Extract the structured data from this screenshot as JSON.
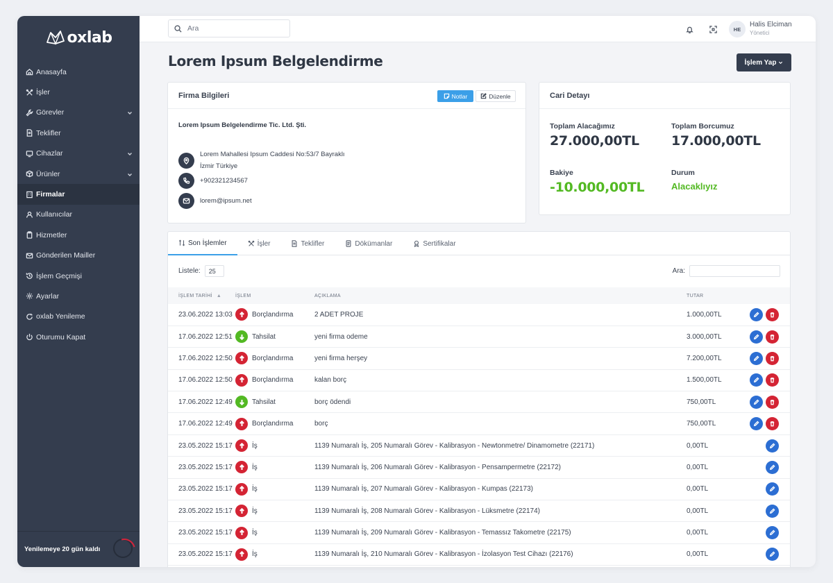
{
  "brand": {
    "logo_text": "oxlab"
  },
  "sidebar": {
    "items": [
      {
        "label": "Anasayfa",
        "icon": "home-icon",
        "chevron": false,
        "active": false
      },
      {
        "label": "İşler",
        "icon": "tools-icon",
        "chevron": false,
        "active": false
      },
      {
        "label": "Görevler",
        "icon": "wrench-icon",
        "chevron": true,
        "active": false
      },
      {
        "label": "Teklifler",
        "icon": "document-icon",
        "chevron": false,
        "active": false
      },
      {
        "label": "Cihazlar",
        "icon": "device-icon",
        "chevron": true,
        "active": false
      },
      {
        "label": "Ürünler",
        "icon": "box-icon",
        "chevron": true,
        "active": false
      },
      {
        "label": "Firmalar",
        "icon": "building-icon",
        "chevron": false,
        "active": true
      },
      {
        "label": "Kullanıcılar",
        "icon": "user-icon",
        "chevron": false,
        "active": false
      },
      {
        "label": "Hizmetler",
        "icon": "clipboard-icon",
        "chevron": false,
        "active": false
      },
      {
        "label": "Gönderilen Mailler",
        "icon": "mail-icon",
        "chevron": false,
        "active": false
      },
      {
        "label": "İşlem Geçmişi",
        "icon": "history-icon",
        "chevron": false,
        "active": false
      },
      {
        "label": "Ayarlar",
        "icon": "gear-icon",
        "chevron": false,
        "active": false
      },
      {
        "label": "oxlab Yenileme",
        "icon": "refresh-icon",
        "chevron": false,
        "active": false
      },
      {
        "label": "Oturumu Kapat",
        "icon": "power-icon",
        "chevron": false,
        "active": false
      }
    ],
    "renewal_text": "Yenilemeye 20 gün kaldı"
  },
  "topbar": {
    "search_placeholder": "Ara",
    "user_initials": "HE",
    "user_name": "Halis Elciman",
    "user_role": "Yönetici"
  },
  "page": {
    "title": "Lorem Ipsum Belgelendirme",
    "action_button": "İşlem Yap"
  },
  "firm": {
    "header": "Firma Bilgileri",
    "notes_button": "Notlar",
    "edit_button": "Düzenle",
    "name": "Lorem Ipsum Belgelendirme Tic. Ltd. Şti.",
    "address_line1": "Lorem Mahallesi Ipsum Caddesi No:53/7 Bayraklı",
    "address_line2": "İzmir Türkiye",
    "phone": "+902321234567",
    "email": "lorem@ipsum.net"
  },
  "cari": {
    "header": "Cari Detayı",
    "receivable_label": "Toplam Alacağımız",
    "receivable_value": "27.000,00TL",
    "debt_label": "Toplam Borcumuz",
    "debt_value": "17.000,00TL",
    "balance_label": "Bakiye",
    "balance_value": "-10.000,00TL",
    "status_label": "Durum",
    "status_value": "Alacaklıyız"
  },
  "tabs": [
    {
      "label": "Son İşlemler",
      "icon": "swap-icon"
    },
    {
      "label": "İşler",
      "icon": "tools-icon"
    },
    {
      "label": "Teklifler",
      "icon": "document-icon"
    },
    {
      "label": "Dökümanlar",
      "icon": "file-icon"
    },
    {
      "label": "Sertifikalar",
      "icon": "award-icon"
    }
  ],
  "table": {
    "list_label": "Listele:",
    "list_size": "25",
    "search_label": "Ara:",
    "columns": [
      "İŞLEM TARİHİ",
      "İŞLEM",
      "AÇIKLAMA",
      "TUTAR"
    ],
    "rows": [
      {
        "date": "23.06.2022 13:03",
        "type": "Borçlandırma",
        "dir": "up",
        "desc": "2 ADET PROJE",
        "amount": "1.000,00TL",
        "deletable": true
      },
      {
        "date": "17.06.2022 12:51",
        "type": "Tahsilat",
        "dir": "down",
        "desc": "yeni firma odeme",
        "amount": "3.000,00TL",
        "deletable": true
      },
      {
        "date": "17.06.2022 12:50",
        "type": "Borçlandırma",
        "dir": "up",
        "desc": "yeni firma herşey",
        "amount": "7.200,00TL",
        "deletable": true
      },
      {
        "date": "17.06.2022 12:50",
        "type": "Borçlandırma",
        "dir": "up",
        "desc": "kalan borç",
        "amount": "1.500,00TL",
        "deletable": true
      },
      {
        "date": "17.06.2022 12:49",
        "type": "Tahsilat",
        "dir": "down",
        "desc": "borç ödendi",
        "amount": "750,00TL",
        "deletable": true
      },
      {
        "date": "17.06.2022 12:49",
        "type": "Borçlandırma",
        "dir": "up",
        "desc": "borç",
        "amount": "750,00TL",
        "deletable": true
      },
      {
        "date": "23.05.2022 15:17",
        "type": "İş",
        "dir": "up",
        "desc": "1139 Numaralı İş, 205 Numaralı Görev - Kalibrasyon - Newtonmetre/ Dinamometre (22171)",
        "amount": "0,00TL",
        "deletable": false
      },
      {
        "date": "23.05.2022 15:17",
        "type": "İş",
        "dir": "up",
        "desc": "1139 Numaralı İş, 206 Numaralı Görev - Kalibrasyon - Pensampermetre (22172)",
        "amount": "0,00TL",
        "deletable": false
      },
      {
        "date": "23.05.2022 15:17",
        "type": "İş",
        "dir": "up",
        "desc": "1139 Numaralı İş, 207 Numaralı Görev - Kalibrasyon - Kumpas (22173)",
        "amount": "0,00TL",
        "deletable": false
      },
      {
        "date": "23.05.2022 15:17",
        "type": "İş",
        "dir": "up",
        "desc": "1139 Numaralı İş, 208 Numaralı Görev - Kalibrasyon - Lüksmetre (22174)",
        "amount": "0,00TL",
        "deletable": false
      },
      {
        "date": "23.05.2022 15:17",
        "type": "İş",
        "dir": "up",
        "desc": "1139 Numaralı İş, 209 Numaralı Görev - Kalibrasyon - Temassız Takometre (22175)",
        "amount": "0,00TL",
        "deletable": false
      },
      {
        "date": "23.05.2022 15:17",
        "type": "İş",
        "dir": "up",
        "desc": "1139 Numaralı İş, 210 Numaralı Görev - Kalibrasyon - İzolasyon Test Cihazı (22176)",
        "amount": "0,00TL",
        "deletable": false
      }
    ]
  },
  "colors": {
    "sidebar": "#343d4e",
    "accent": "#3b9fe8",
    "debit": "#d42434",
    "credit": "#53b923",
    "edit": "#2c6ed3"
  }
}
